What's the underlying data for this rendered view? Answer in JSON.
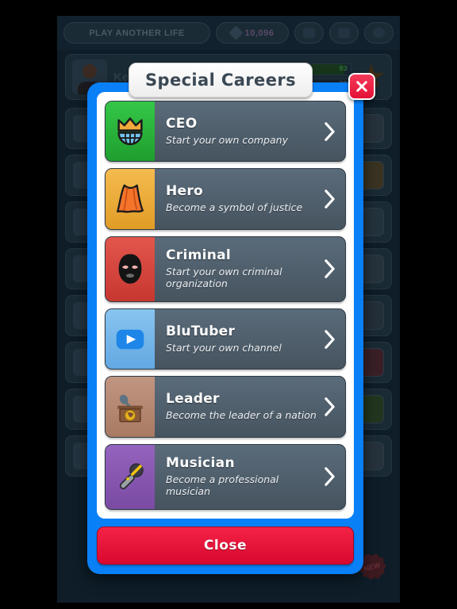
{
  "background": {
    "topbar": {
      "play_another_life_label": "PLAY ANOTHER LIFE",
      "gem_count": "10,096",
      "cloud_icon": "cloud-icon",
      "save_icon": "floppy-save-icon",
      "settings_icon": "gear-icon"
    },
    "character": {
      "name": "Kenneth Rosen",
      "health_value": "93",
      "age_value": "30"
    },
    "new_badge_label": "NEW"
  },
  "modal": {
    "title": "Special Careers",
    "close_x_icon": "close-x-icon",
    "close_button_label": "Close",
    "accent_color": "#0a80f7",
    "close_button_color": "#e31236",
    "careers": [
      {
        "name": "CEO",
        "description": "Start your own company",
        "icon": "crown-globe-icon",
        "tile_color": "#2db83d",
        "chevron_icon": "chevron-right-icon"
      },
      {
        "name": "Hero",
        "description": "Become a symbol of justice",
        "icon": "cape-icon",
        "tile_color": "#eeab33",
        "chevron_icon": "chevron-right-icon"
      },
      {
        "name": "Criminal",
        "description": "Start your own criminal organization",
        "icon": "balaclava-mask-icon",
        "tile_color": "#d9453f",
        "chevron_icon": "chevron-right-icon"
      },
      {
        "name": "BluTuber",
        "description": "Start your own channel",
        "icon": "play-button-icon",
        "tile_color": "#74b6ea",
        "chevron_icon": "chevron-right-icon"
      },
      {
        "name": "Leader",
        "description": "Become the leader of a nation",
        "icon": "podium-microphone-icon",
        "tile_color": "#b58872",
        "chevron_icon": "chevron-right-icon"
      },
      {
        "name": "Musician",
        "description": "Become a professional musician",
        "icon": "microphone-icon",
        "tile_color": "#8557ad",
        "chevron_icon": "chevron-right-icon"
      }
    ]
  }
}
